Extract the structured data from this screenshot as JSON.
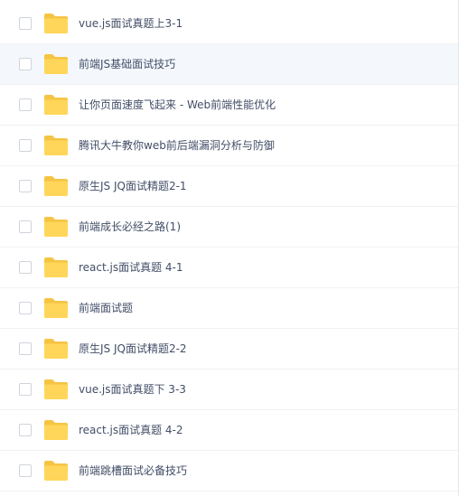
{
  "file_list": {
    "folder_icon": "folder-icon",
    "colors": {
      "folder": "#ffd659",
      "folder_tab": "#f6c443",
      "selected_row": "#f4f8fd",
      "text": "#424e67"
    },
    "items": [
      {
        "name": "vue.js面试真题上3-1",
        "selected": false
      },
      {
        "name": "前端JS基础面试技巧",
        "selected": true
      },
      {
        "name": "让你页面速度飞起来 - Web前端性能优化",
        "selected": false
      },
      {
        "name": "腾讯大牛教你web前后端漏洞分析与防御",
        "selected": false
      },
      {
        "name": "原生JS JQ面试精题2-1",
        "selected": false
      },
      {
        "name": "前端成长必经之路(1)",
        "selected": false
      },
      {
        "name": "react.js面试真题 4-1",
        "selected": false
      },
      {
        "name": "前端面试题",
        "selected": false
      },
      {
        "name": "原生JS JQ面试精题2-2",
        "selected": false
      },
      {
        "name": "vue.js面试真题下 3-3",
        "selected": false
      },
      {
        "name": "react.js面试真题 4-2",
        "selected": false
      },
      {
        "name": "前端跳槽面试必备技巧",
        "selected": false
      }
    ]
  }
}
